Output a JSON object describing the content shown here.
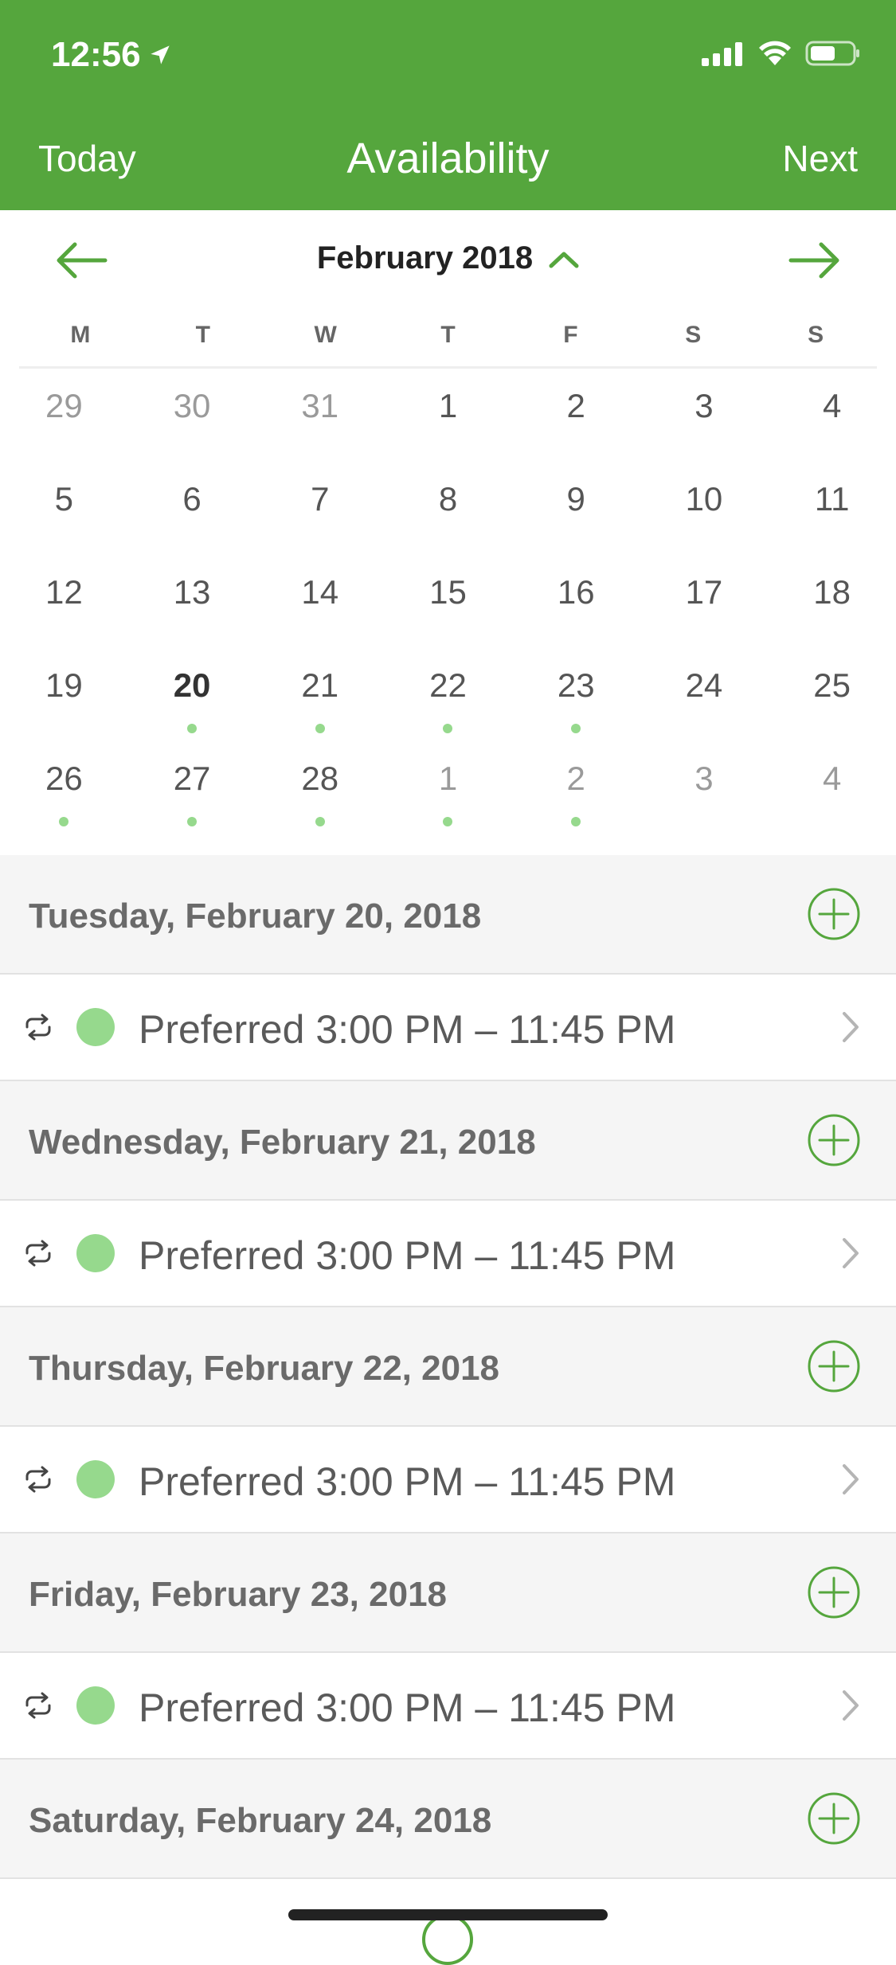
{
  "status_bar": {
    "time": "12:56"
  },
  "nav": {
    "left": "Today",
    "title": "Availability",
    "right": "Next"
  },
  "calendar": {
    "month": "February 2018",
    "weekdays": [
      "M",
      "T",
      "W",
      "T",
      "F",
      "S",
      "S"
    ],
    "weeks": [
      [
        {
          "d": "29",
          "muted": true
        },
        {
          "d": "30",
          "muted": true
        },
        {
          "d": "31",
          "muted": true
        },
        {
          "d": "1"
        },
        {
          "d": "2"
        },
        {
          "d": "3"
        },
        {
          "d": "4"
        }
      ],
      [
        {
          "d": "5"
        },
        {
          "d": "6"
        },
        {
          "d": "7"
        },
        {
          "d": "8"
        },
        {
          "d": "9"
        },
        {
          "d": "10"
        },
        {
          "d": "11"
        }
      ],
      [
        {
          "d": "12"
        },
        {
          "d": "13"
        },
        {
          "d": "14"
        },
        {
          "d": "15"
        },
        {
          "d": "16"
        },
        {
          "d": "17"
        },
        {
          "d": "18"
        }
      ],
      [
        {
          "d": "19"
        },
        {
          "d": "20",
          "bold": true,
          "dot": true
        },
        {
          "d": "21",
          "dot": true
        },
        {
          "d": "22",
          "dot": true
        },
        {
          "d": "23",
          "dot": true
        },
        {
          "d": "24"
        },
        {
          "d": "25"
        }
      ],
      [
        {
          "d": "26",
          "dot": true
        },
        {
          "d": "27",
          "dot": true
        },
        {
          "d": "28",
          "dot": true
        },
        {
          "d": "1",
          "muted": true,
          "dot": true
        },
        {
          "d": "2",
          "muted": true,
          "dot": true
        },
        {
          "d": "3",
          "muted": true
        },
        {
          "d": "4",
          "muted": true
        }
      ]
    ]
  },
  "sections": [
    {
      "title": "Tuesday, February 20, 2018",
      "entry": "Preferred 3:00 PM – 11:45 PM"
    },
    {
      "title": "Wednesday, February 21, 2018",
      "entry": "Preferred 3:00 PM – 11:45 PM"
    },
    {
      "title": "Thursday, February 22, 2018",
      "entry": "Preferred 3:00 PM – 11:45 PM"
    },
    {
      "title": "Friday, February 23, 2018",
      "entry": "Preferred 3:00 PM – 11:45 PM"
    },
    {
      "title": "Saturday, February 24, 2018"
    }
  ],
  "colors": {
    "brand": "#55a63d",
    "dot": "#96d98d"
  }
}
